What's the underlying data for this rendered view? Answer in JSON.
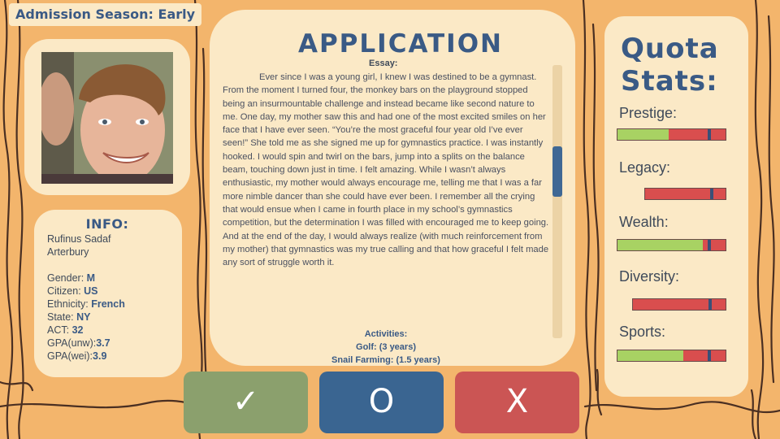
{
  "season": "Admission Season: Early",
  "info": {
    "title": "INFO:",
    "name_line1": "Rufinus Sadaf",
    "name_line2": "Arterbury",
    "gender_label": "Gender: ",
    "gender": "M",
    "citizen_label": "Citizen: ",
    "citizen": "US",
    "ethnicity_label": "Ethnicity: ",
    "ethnicity": "French",
    "state_label": "State: ",
    "state": "NY",
    "act_label": "ACT: ",
    "act": "32",
    "gpa_unw_label": "GPA(unw):",
    "gpa_unw": "3.7",
    "gpa_wei_label": "GPA(wei):",
    "gpa_wei": "3.9"
  },
  "application": {
    "title": "APPLICATION",
    "essay_label": "Essay:",
    "essay": "Ever since I was a young girl, I knew I was destined to be a gymnast. From the moment I turned four, the monkey bars on the playground stopped being an insurmountable challenge and instead became like second nature to me. One day, my mother saw this and had one of the most excited smiles on her face that I have ever seen. “You’re the most graceful four year old I’ve ever seen!” She told me as she signed me up for gymnastics practice. I was instantly hooked. I would spin and twirl on the bars, jump into a splits on the balance beam, touching down just in time. I felt amazing. While I wasn’t always enthusiastic, my mother would always encourage me, telling me that I was a far more nimble dancer than she could have ever been. I remember all the crying that would ensue when I came in fourth place in my school’s gymnastics competition, but the determination I was filled with encouraged me to keep going. And at the end of the day, I would always realize (with much reinforcement from my mother) that gymnastics was my true calling and that how graceful I felt made any sort of struggle worth it.",
    "activities_label": "Activities:",
    "activities": [
      "Golf: (3 years)",
      "Snail Farming: (1.5 years)"
    ]
  },
  "buttons": {
    "accept": "✓",
    "wait": "O",
    "reject": "X"
  },
  "quota": {
    "title_line1": "Quota",
    "title_line2": "Stats:",
    "stats": [
      {
        "label": "Prestige:",
        "filled": 0.47,
        "marker": 0.85
      },
      {
        "label": "Legacy:",
        "filled": 0.0,
        "marker": 0.83
      },
      {
        "label": "Wealth:",
        "filled": 0.79,
        "marker": 0.85
      },
      {
        "label": "Diversity:",
        "filled": 0.0,
        "marker": 0.83
      },
      {
        "label": "Sports:",
        "filled": 0.61,
        "marker": 0.85
      }
    ]
  },
  "colors": {
    "bar_fill": "#a8d263",
    "bar_empty": "#d94e4e",
    "accept": "#8ba06d",
    "wait": "#3a6591",
    "reject": "#cb5554",
    "title": "#3a5a85"
  }
}
